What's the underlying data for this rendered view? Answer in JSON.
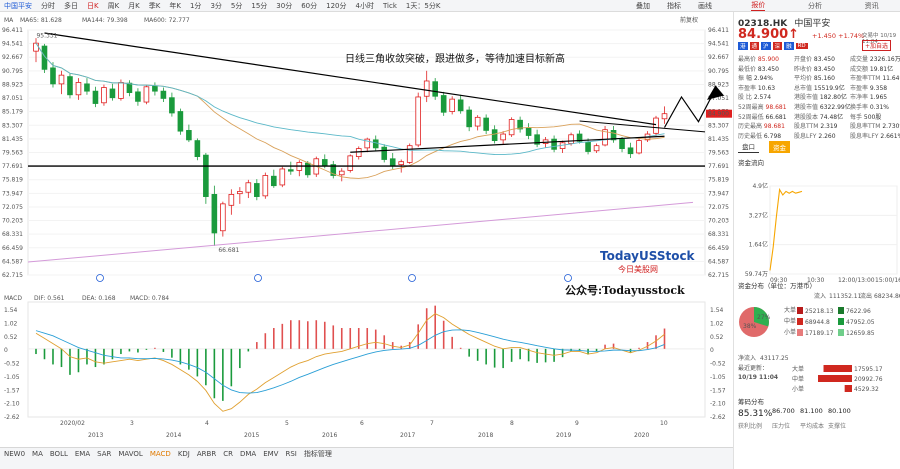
{
  "toolbar": {
    "symbol": "中国平安",
    "items": [
      "分时",
      "多日",
      "日K",
      "周K",
      "月K",
      "季K",
      "年K",
      "1分",
      "3分",
      "5分",
      "15分",
      "30分",
      "60分",
      "120分",
      "4小时",
      "Tick",
      "1天：5分K"
    ],
    "active_index": 2,
    "right": [
      "叠加",
      "指标",
      "画线"
    ]
  },
  "side_tabs": [
    "报价",
    "分析",
    "资讯"
  ],
  "quote": {
    "code": "02318.HK",
    "name": "中国平安",
    "price": "84.900",
    "arrow": "↑",
    "change": "+1.450",
    "change_pct": "+1.74%",
    "status": "交易中 10/19 11:04",
    "follow_btn": "+加自选",
    "badges": [
      "港",
      "通",
      "沪",
      "深",
      "融",
      "RD"
    ],
    "fields": [
      [
        "最高价",
        "85.900"
      ],
      [
        "开盘价",
        "83.450"
      ],
      [
        "成交量",
        "2326.16万"
      ],
      [
        "最低价",
        "83.450"
      ],
      [
        "昨收价",
        "83.450"
      ],
      [
        "成交额",
        "19.81亿"
      ],
      [
        "振 幅",
        "2.94%"
      ],
      [
        "平均价",
        "85.160"
      ],
      [
        "市盈率TTM",
        "11.649"
      ],
      [
        "市盈率",
        "10.63"
      ],
      [
        "总市值",
        "15519.9亿"
      ],
      [
        "市盈率",
        "9.358"
      ],
      [
        "股 比",
        "2.574"
      ],
      [
        "港股市值",
        "182.80亿"
      ],
      [
        "市净率",
        "1.965"
      ],
      [
        "52周最高",
        "98.681"
      ],
      [
        "港股市值",
        "6322.99亿"
      ],
      [
        "换手率",
        "0.31%"
      ],
      [
        "52周最低",
        "66.681"
      ],
      [
        "港股股本",
        "74.48亿"
      ],
      [
        "每手",
        "500股"
      ],
      [
        "历史最高",
        "98.681"
      ],
      [
        "股息TTM",
        "2.319"
      ],
      [
        "股息率TTM",
        "2.730%"
      ],
      [
        "历史最低",
        "6.798"
      ],
      [
        "股息LFY",
        "2.260"
      ],
      [
        "股息率LFY",
        "2.661%"
      ]
    ],
    "sub_tabs": [
      "盘口",
      "资金"
    ],
    "flow_title": "资金流向"
  },
  "mini_chart": {
    "y_labels": [
      "4.9亿",
      "3.27亿",
      "1.64亿",
      "59.74万"
    ],
    "x_labels": [
      "09:30",
      "10:30",
      "12:00/13:00",
      "15:00/16:00"
    ],
    "values": [
      0.2,
      1.5,
      3.2,
      4.7,
      4.4,
      4.6,
      4.5,
      4.6,
      4.5,
      4.55,
      4.6
    ]
  },
  "fund_dist": {
    "title": "资金分布（单位：万港币）",
    "inflow_label": "流入",
    "inflow": "111352.11",
    "outflow_label": "流出",
    "outflow": "68234.86",
    "rows": [
      [
        "大单",
        "25218.13",
        "7622.96"
      ],
      [
        "中单",
        "68944.8",
        "47952.05"
      ],
      [
        "小单",
        "17189.17",
        "12659.85"
      ]
    ],
    "pie": {
      "in_pct": "38%",
      "out_pct": "27%"
    },
    "net_label": "净流入",
    "net": "43117.25",
    "latest_label": "最近更新：",
    "latest_time": "10/19 11:04",
    "net_rows": [
      [
        "大单",
        "17595.17"
      ],
      [
        "中单",
        "20992.76"
      ],
      [
        "小单",
        "4529.32"
      ]
    ]
  },
  "chips": {
    "title": "筹码分布",
    "items": [
      [
        "85.31%",
        "获利比例"
      ],
      [
        "86.700",
        "压力位"
      ],
      [
        "81.100",
        "平均成本"
      ],
      [
        "80.100",
        "支撑位"
      ]
    ]
  },
  "main_chart": {
    "ma_legend": [
      {
        "label": "MA",
        "color": "#333333"
      },
      {
        "label": "MA65: 81.628",
        "color": "#e08a00"
      },
      {
        "label": "MA144: 79.398",
        "color": "#2a9fd6"
      },
      {
        "label": "MA600: 72.777",
        "color": "#c070d0"
      }
    ],
    "right_label": "前复权",
    "y_labels": [
      "96.411",
      "94.541",
      "92.667",
      "90.795",
      "88.923",
      "87.051",
      "85.179",
      "83.307",
      "81.435",
      "79.563",
      "77.691",
      "75.819",
      "73.947",
      "72.075",
      "70.203",
      "68.331",
      "66.459",
      "64.587",
      "62.715"
    ],
    "ylim": [
      62.715,
      96.411
    ],
    "annotation": "日线三角收敛突破，跟进做多，等待加速目标新高",
    "high_label": "95.331",
    "low_label": "66.681",
    "price_tag": "84.900",
    "watermark_brand": "TodayUSStock",
    "watermark_sub": "今日美股网",
    "wechat": "公众号:Todayusstock",
    "x_labels": [
      "2020/02",
      "3",
      "4",
      "5",
      "6",
      "7",
      "8",
      "9",
      "10"
    ],
    "year_labels": [
      "2013",
      "2014",
      "2015",
      "2016",
      "2017",
      "2018",
      "2019",
      "2020"
    ]
  },
  "chart_data": {
    "type": "candlestick",
    "ylim": [
      62.715,
      96.411
    ],
    "ohlc": [
      [
        93.5,
        95.3,
        92.0,
        94.6
      ],
      [
        94.2,
        94.5,
        90.5,
        91.0
      ],
      [
        91.2,
        92.0,
        88.5,
        89.0
      ],
      [
        89.0,
        90.8,
        87.6,
        90.2
      ],
      [
        90.0,
        90.5,
        87.0,
        87.5
      ],
      [
        87.5,
        89.8,
        86.8,
        89.2
      ],
      [
        89.0,
        89.8,
        87.5,
        88.0
      ],
      [
        88.0,
        88.6,
        85.8,
        86.3
      ],
      [
        86.4,
        88.9,
        86.0,
        88.5
      ],
      [
        88.3,
        89.0,
        86.7,
        87.1
      ],
      [
        87.0,
        89.6,
        86.7,
        89.2
      ],
      [
        89.1,
        89.5,
        87.3,
        87.8
      ],
      [
        87.9,
        88.4,
        86.0,
        86.6
      ],
      [
        86.5,
        88.8,
        86.2,
        88.6
      ],
      [
        88.7,
        89.2,
        87.4,
        88.0
      ],
      [
        88.0,
        88.5,
        86.5,
        87.0
      ],
      [
        87.1,
        87.8,
        84.5,
        85.0
      ],
      [
        85.2,
        85.6,
        82.0,
        82.5
      ],
      [
        82.6,
        83.4,
        81.0,
        81.3
      ],
      [
        81.2,
        81.5,
        78.5,
        79.0
      ],
      [
        79.2,
        79.5,
        72.5,
        73.5
      ],
      [
        73.8,
        75.0,
        66.7,
        68.5
      ],
      [
        68.8,
        72.8,
        68.0,
        72.5
      ],
      [
        72.3,
        74.5,
        71.0,
        73.8
      ],
      [
        73.9,
        74.8,
        72.5,
        74.2
      ],
      [
        74.1,
        75.8,
        73.3,
        75.4
      ],
      [
        75.3,
        75.9,
        73.0,
        73.5
      ],
      [
        73.6,
        76.8,
        73.2,
        76.4
      ],
      [
        76.3,
        77.2,
        74.7,
        75.0
      ],
      [
        75.1,
        77.6,
        74.8,
        77.3
      ],
      [
        77.2,
        78.3,
        76.5,
        77.0
      ],
      [
        77.1,
        78.5,
        76.3,
        78.2
      ],
      [
        78.1,
        78.4,
        76.1,
        76.5
      ],
      [
        76.6,
        79.0,
        76.2,
        78.7
      ],
      [
        78.6,
        79.3,
        77.4,
        77.8
      ],
      [
        77.9,
        78.4,
        76.0,
        76.4
      ],
      [
        76.5,
        77.4,
        75.6,
        77.0
      ],
      [
        77.1,
        79.3,
        76.8,
        79.1
      ],
      [
        79.0,
        80.4,
        78.6,
        80.1
      ],
      [
        80.2,
        81.6,
        79.6,
        81.4
      ],
      [
        81.3,
        81.9,
        79.8,
        80.2
      ],
      [
        80.3,
        80.7,
        78.2,
        78.6
      ],
      [
        78.7,
        79.5,
        77.3,
        77.8
      ],
      [
        77.9,
        78.6,
        76.8,
        78.3
      ],
      [
        78.2,
        80.8,
        78.0,
        80.5
      ],
      [
        80.6,
        87.8,
        80.3,
        87.2
      ],
      [
        87.3,
        90.8,
        86.5,
        89.4
      ],
      [
        89.3,
        89.8,
        86.8,
        87.3
      ],
      [
        87.4,
        87.9,
        84.6,
        85.1
      ],
      [
        85.2,
        87.3,
        84.8,
        86.9
      ],
      [
        86.8,
        87.5,
        84.9,
        85.3
      ],
      [
        85.4,
        85.9,
        82.5,
        83.1
      ],
      [
        83.2,
        84.7,
        82.6,
        84.4
      ],
      [
        84.3,
        84.8,
        82.1,
        82.6
      ],
      [
        82.7,
        83.3,
        80.8,
        81.2
      ],
      [
        81.3,
        82.5,
        80.6,
        82.1
      ],
      [
        82.0,
        84.4,
        81.7,
        84.1
      ],
      [
        84.0,
        84.5,
        82.3,
        82.8
      ],
      [
        82.9,
        83.6,
        81.4,
        81.9
      ],
      [
        82.0,
        82.7,
        80.3,
        80.7
      ],
      [
        80.8,
        81.7,
        80.2,
        81.3
      ],
      [
        81.4,
        81.9,
        79.6,
        80.0
      ],
      [
        80.1,
        81.2,
        79.5,
        80.9
      ],
      [
        80.8,
        82.3,
        80.5,
        82.0
      ],
      [
        82.1,
        82.6,
        80.8,
        81.1
      ],
      [
        81.0,
        81.5,
        79.3,
        79.7
      ],
      [
        79.8,
        80.8,
        79.5,
        80.5
      ],
      [
        80.6,
        83.2,
        80.4,
        82.7
      ],
      [
        82.6,
        83.2,
        80.9,
        81.3
      ],
      [
        81.4,
        81.7,
        79.6,
        80.1
      ],
      [
        80.2,
        80.9,
        78.8,
        79.4
      ],
      [
        79.5,
        81.5,
        79.3,
        81.2
      ],
      [
        81.3,
        82.5,
        81.0,
        82.1
      ],
      [
        82.2,
        84.6,
        81.8,
        84.3
      ],
      [
        84.2,
        85.9,
        83.5,
        84.9
      ]
    ],
    "macd": {
      "y_labels": [
        "1.54",
        "1.02",
        "0.52",
        "0",
        "-0.52",
        "-1.05",
        "-1.57",
        "-2.10",
        "-2.62"
      ],
      "ylim": [
        -2.62,
        1.8
      ],
      "legend": [
        [
          "MACD",
          "#333333"
        ],
        [
          "DIF: 0.561",
          "#e08a00"
        ],
        [
          "DEA: 0.168",
          "#2a9fd6"
        ],
        [
          "MACD: 0.784",
          "#c070d0"
        ]
      ],
      "dif": [
        0.6,
        0.4,
        0.2,
        0.0,
        -0.3,
        -0.4,
        -0.35,
        -0.5,
        -0.55,
        -0.5,
        -0.45,
        -0.4,
        -0.45,
        -0.4,
        -0.35,
        -0.45,
        -0.6,
        -0.8,
        -1.0,
        -1.25,
        -1.6,
        -2.1,
        -2.4,
        -2.3,
        -2.05,
        -1.75,
        -1.55,
        -1.3,
        -1.1,
        -0.9,
        -0.7,
        -0.55,
        -0.45,
        -0.3,
        -0.2,
        -0.15,
        -0.1,
        0.0,
        0.1,
        0.2,
        0.25,
        0.2,
        0.1,
        0.05,
        0.15,
        0.6,
        1.1,
        1.35,
        1.2,
        0.95,
        0.75,
        0.55,
        0.4,
        0.25,
        0.1,
        0.0,
        0.05,
        0.05,
        -0.05,
        -0.15,
        -0.2,
        -0.25,
        -0.2,
        -0.1,
        -0.1,
        -0.2,
        -0.15,
        0.0,
        0.05,
        -0.05,
        -0.15,
        -0.05,
        0.1,
        0.3,
        0.56
      ],
      "dea": [
        0.7,
        0.6,
        0.5,
        0.35,
        0.2,
        0.05,
        -0.05,
        -0.15,
        -0.25,
        -0.3,
        -0.35,
        -0.35,
        -0.38,
        -0.38,
        -0.37,
        -0.39,
        -0.43,
        -0.5,
        -0.6,
        -0.72,
        -0.9,
        -1.15,
        -1.4,
        -1.58,
        -1.68,
        -1.7,
        -1.68,
        -1.6,
        -1.5,
        -1.38,
        -1.25,
        -1.1,
        -0.98,
        -0.85,
        -0.72,
        -0.6,
        -0.5,
        -0.4,
        -0.3,
        -0.2,
        -0.12,
        -0.06,
        -0.03,
        -0.01,
        0.02,
        0.13,
        0.32,
        0.52,
        0.66,
        0.72,
        0.73,
        0.7,
        0.63,
        0.55,
        0.46,
        0.37,
        0.3,
        0.25,
        0.19,
        0.12,
        0.06,
        0.0,
        -0.04,
        -0.05,
        -0.06,
        -0.09,
        -0.1,
        -0.08,
        -0.05,
        -0.05,
        -0.07,
        -0.07,
        -0.03,
        0.04,
        0.17
      ]
    }
  }
}
